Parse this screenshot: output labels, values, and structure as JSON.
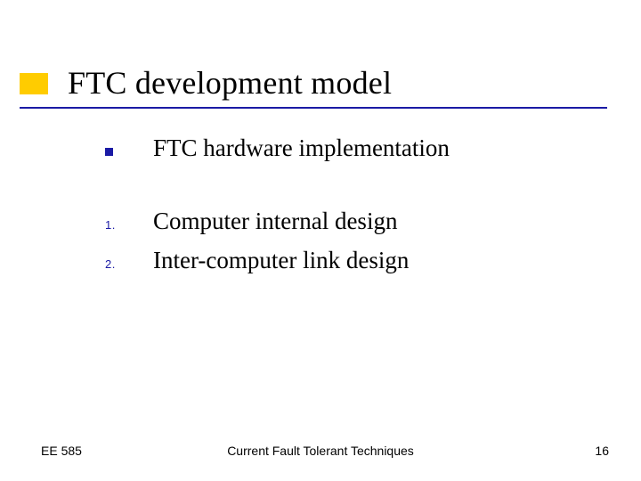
{
  "title": "FTC development model",
  "items": [
    {
      "marker_type": "square",
      "marker": "",
      "text": "FTC hardware implementation"
    },
    {
      "marker_type": "num",
      "marker": "1.",
      "text": "Computer internal design"
    },
    {
      "marker_type": "num",
      "marker": "2.",
      "text": "Inter-computer link design"
    }
  ],
  "footer": {
    "left": "EE 585",
    "center": "Current Fault Tolerant Techniques",
    "right": "16"
  }
}
